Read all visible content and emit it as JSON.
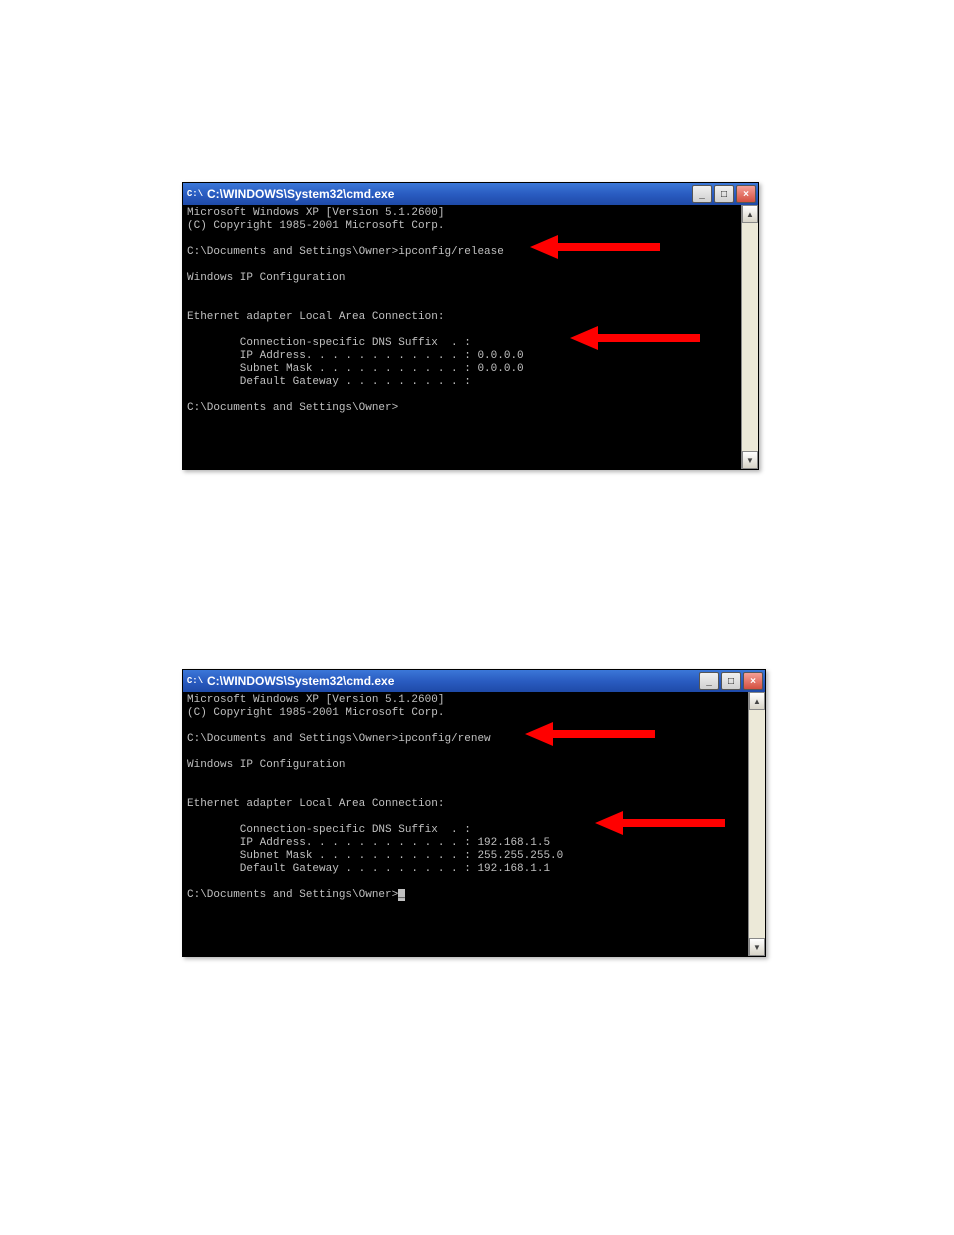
{
  "window1": {
    "title": "C:\\WINDOWS\\System32\\cmd.exe",
    "icon_text": "C:\\",
    "lines": {
      "l0": "Microsoft Windows XP [Version 5.1.2600]",
      "l1": "(C) Copyright 1985-2001 Microsoft Corp.",
      "l2": "",
      "l3": "C:\\Documents and Settings\\Owner>ipconfig/release",
      "l4": "",
      "l5": "Windows IP Configuration",
      "l6": "",
      "l7": "",
      "l8": "Ethernet adapter Local Area Connection:",
      "l9": "",
      "l10": "        Connection-specific DNS Suffix  . :",
      "l11": "        IP Address. . . . . . . . . . . . : 0.0.0.0",
      "l12": "        Subnet Mask . . . . . . . . . . . : 0.0.0.0",
      "l13": "        Default Gateway . . . . . . . . . :",
      "l14": "",
      "l15": "C:\\Documents and Settings\\Owner>"
    },
    "buttons": {
      "min": "_",
      "max": "□",
      "close": "×"
    },
    "scroll": {
      "up": "▲",
      "down": "▼"
    }
  },
  "window2": {
    "title": "C:\\WINDOWS\\System32\\cmd.exe",
    "icon_text": "C:\\",
    "lines": {
      "l0": "Microsoft Windows XP [Version 5.1.2600]",
      "l1": "(C) Copyright 1985-2001 Microsoft Corp.",
      "l2": "",
      "l3": "C:\\Documents and Settings\\Owner>ipconfig/renew",
      "l4": "",
      "l5": "Windows IP Configuration",
      "l6": "",
      "l7": "",
      "l8": "Ethernet adapter Local Area Connection:",
      "l9": "",
      "l10": "        Connection-specific DNS Suffix  . :",
      "l11": "        IP Address. . . . . . . . . . . . : 192.168.1.5",
      "l12": "        Subnet Mask . . . . . . . . . . . : 255.255.255.0",
      "l13": "        Default Gateway . . . . . . . . . : 192.168.1.1",
      "l14": "",
      "l15p": "C:\\Documents and Settings\\Owner>",
      "l15c": "_"
    },
    "buttons": {
      "min": "_",
      "max": "□",
      "close": "×"
    },
    "scroll": {
      "up": "▲",
      "down": "▼"
    }
  }
}
